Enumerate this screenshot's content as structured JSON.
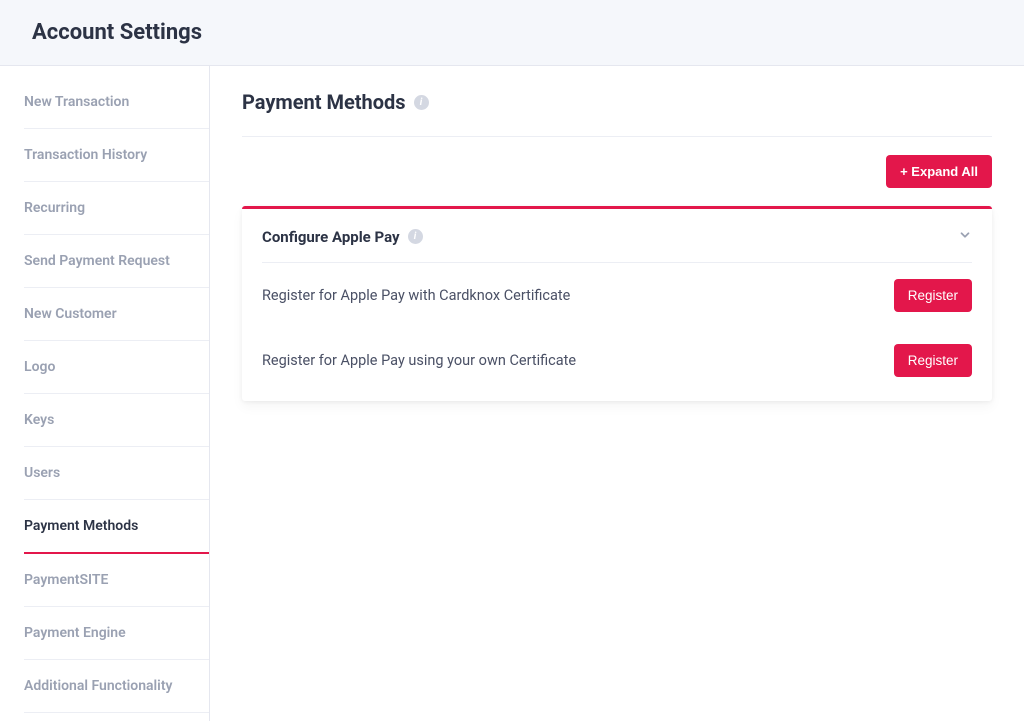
{
  "header": {
    "title": "Account Settings"
  },
  "sidebar": {
    "items": [
      {
        "label": "New Transaction",
        "active": false
      },
      {
        "label": "Transaction History",
        "active": false
      },
      {
        "label": "Recurring",
        "active": false
      },
      {
        "label": "Send Payment Request",
        "active": false
      },
      {
        "label": "New Customer",
        "active": false
      },
      {
        "label": "Logo",
        "active": false
      },
      {
        "label": "Keys",
        "active": false
      },
      {
        "label": "Users",
        "active": false
      },
      {
        "label": "Payment Methods",
        "active": true
      },
      {
        "label": "PaymentSITE",
        "active": false
      },
      {
        "label": "Payment Engine",
        "active": false
      },
      {
        "label": "Additional Functionality",
        "active": false
      }
    ]
  },
  "main": {
    "title": "Payment Methods",
    "expand_all_label": "+ Expand All",
    "card": {
      "title": "Configure Apple Pay",
      "rows": [
        {
          "label": "Register for Apple Pay with Cardknox Certificate",
          "button": "Register"
        },
        {
          "label": "Register for Apple Pay using your own Certificate",
          "button": "Register"
        }
      ]
    }
  }
}
